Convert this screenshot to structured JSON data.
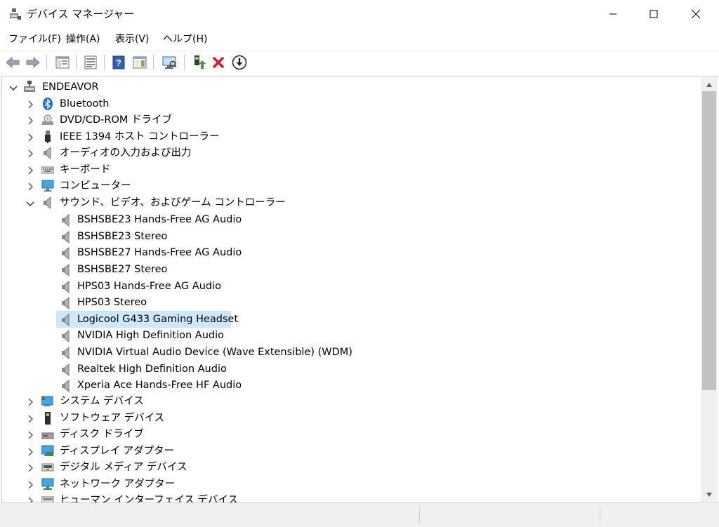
{
  "window": {
    "title": "デバイス マネージャー"
  },
  "menu": [
    {
      "label": "ファイル(F)"
    },
    {
      "label": "操作(A)"
    },
    {
      "label": "表示(V)"
    },
    {
      "label": "ヘルプ(H)"
    }
  ],
  "toolbar": [
    {
      "icon": "back-arrow-icon"
    },
    {
      "icon": "forward-arrow-icon"
    },
    {
      "icon": "show-hide-console-tree-icon"
    },
    {
      "icon": "properties-icon"
    },
    {
      "icon": "help-icon"
    },
    {
      "icon": "show-action-pane-icon"
    },
    {
      "icon": "scan-hardware-changes-icon"
    },
    {
      "icon": "update-driver-icon"
    },
    {
      "icon": "uninstall-device-icon"
    },
    {
      "icon": "download-install-icon"
    }
  ],
  "tree": {
    "root": "ENDEAVOR",
    "categories_top": [
      {
        "label": "Bluetooth",
        "icon": "bluetooth-icon"
      },
      {
        "label": "DVD/CD-ROM ドライブ",
        "icon": "dvd-drive-icon"
      },
      {
        "label": "IEEE 1394 ホスト コントローラー",
        "icon": "usb-plug-icon"
      },
      {
        "label": "オーディオの入力および出力",
        "icon": "speaker-icon"
      },
      {
        "label": "キーボード",
        "icon": "keyboard-icon"
      },
      {
        "label": "コンピューター",
        "icon": "monitor-icon"
      }
    ],
    "expanded_category": {
      "label": "サウンド、ビデオ、およびゲーム コントローラー",
      "icon": "speaker-icon"
    },
    "sound_devices": [
      {
        "label": "BSHSBE23 Hands-Free AG Audio"
      },
      {
        "label": "BSHSBE23 Stereo"
      },
      {
        "label": "BSHSBE27 Hands-Free AG Audio"
      },
      {
        "label": "BSHSBE27 Stereo"
      },
      {
        "label": "HPS03 Hands-Free AG Audio"
      },
      {
        "label": "HPS03 Stereo"
      },
      {
        "label": "Logicool G433 Gaming Headset",
        "selected": true
      },
      {
        "label": "NVIDIA High Definition Audio"
      },
      {
        "label": "NVIDIA Virtual Audio Device (Wave Extensible) (WDM)"
      },
      {
        "label": "Realtek High Definition Audio"
      },
      {
        "label": "Xperia Ace Hands-Free HF Audio"
      }
    ],
    "categories_bottom": [
      {
        "label": "システム デバイス",
        "icon": "system-devices-icon"
      },
      {
        "label": "ソフトウェア デバイス",
        "icon": "software-device-icon"
      },
      {
        "label": "ディスク ドライブ",
        "icon": "disk-drive-icon"
      },
      {
        "label": "ディスプレイ アダプター",
        "icon": "display-adapter-icon"
      },
      {
        "label": "デジタル メディア デバイス",
        "icon": "digital-media-icon"
      },
      {
        "label": "ネットワーク アダプター",
        "icon": "network-adapter-icon"
      },
      {
        "label": "ヒューマン インターフェイス デバイス",
        "icon": "hid-icon"
      }
    ]
  },
  "colors": {
    "selection": "#cce8ff",
    "uninstall_red": "#e81123",
    "help_blue": "#2d5fb3"
  }
}
